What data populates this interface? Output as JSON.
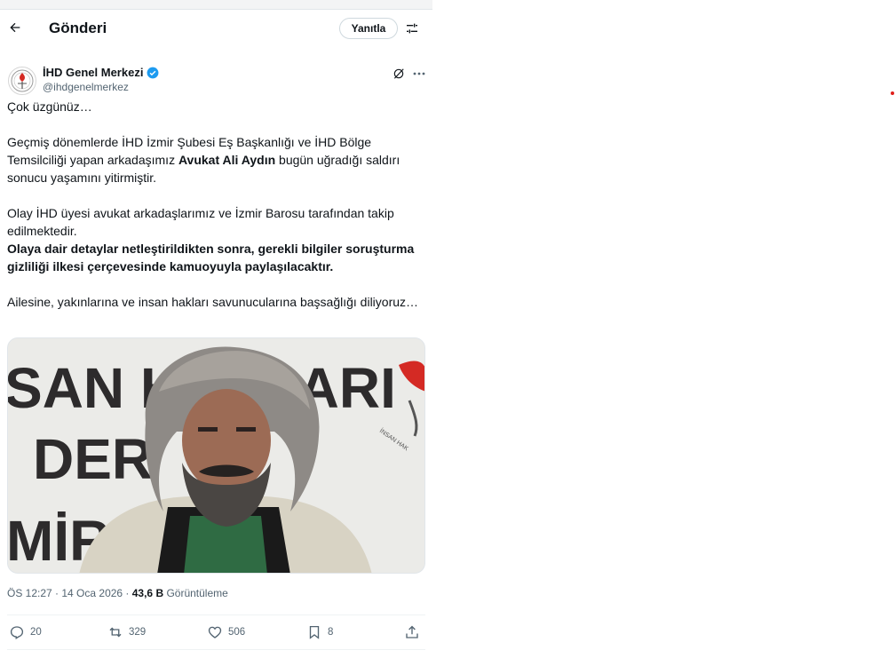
{
  "header": {
    "title": "Gönderi",
    "reply_label": "Yanıtla"
  },
  "author": {
    "name": "İHD Genel Merkezi",
    "handle": "@ihdgenelmerkez"
  },
  "post": {
    "p1": "Çok üzgünüz…",
    "p2_before": "Geçmiş dönemlerde İHD İzmir Şubesi Eş Başkanlığı ve İHD Bölge Temsilciliği yapan arkadaşımız ",
    "p2_bold": "Avukat Ali Aydın",
    "p2_after": " bugün uğradığı saldırı sonucu yaşamını yitirmiştir.",
    "p3": "Olay İHD üyesi avukat arkadaşlarımız ve İzmir Barosu tarafından takip edilmektedir.",
    "p4_bold": "Olaya dair detaylar netleştirildikten sonra, gerekli bilgiler soruşturma gizliliği ilkesi çerçevesinde kamuoyuyla paylaşılacaktır.",
    "p5": "Ailesine, yakınlarına ve insan hakları savunucularına başsağlığı diliyoruz…"
  },
  "media": {
    "banner_line1": "SAN HAKLARI",
    "banner_line2": "DER",
    "banner_line3": "MİR",
    "banner_small": "İNSAN HAK"
  },
  "meta": {
    "time": "ÖS 12:27 · 14 Oca 2026 · ",
    "views_count": "43,6 B",
    "views_label": " Görüntüleme"
  },
  "actions": {
    "replies": "20",
    "reposts": "329",
    "likes": "506",
    "bookmarks": "8"
  },
  "colors": {
    "accent_blue": "#1d9bf0",
    "text_secondary": "#536471",
    "logo_red": "#d42a24"
  }
}
